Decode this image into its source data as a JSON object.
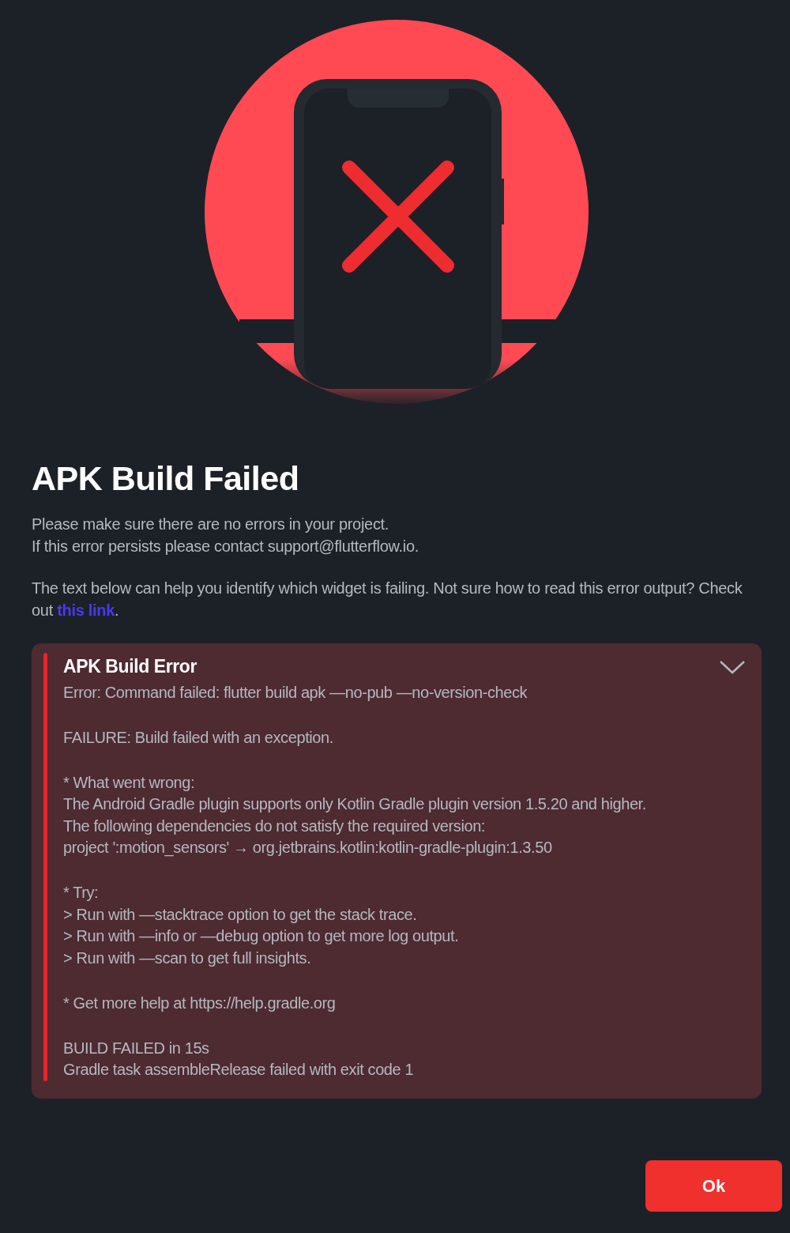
{
  "dialog": {
    "title": "APK Build Failed",
    "message_lines": [
      "Please make sure there are no errors in your project.",
      "If this error persists please contact support@flutterflow.io."
    ],
    "help_text": "The text below can help you identify which widget is failing. Not sure how to read this error output? Check out ",
    "help_link": "this link",
    "help_end": ".",
    "error_panel": {
      "title": "APK Build Error",
      "expanded": true,
      "blocks": [
        [
          "Error: Command failed: flutter build apk —no-pub —no-version-check"
        ],
        [
          "FAILURE: Build failed with an exception."
        ],
        [
          "* What went wrong:",
          "The Android Gradle plugin supports only Kotlin Gradle plugin version 1.5.20 and higher.",
          "The following dependencies do not satisfy the required version:",
          "project ':motion_sensors' → org.jetbrains.kotlin:kotlin-gradle-plugin:1.3.50"
        ],
        [
          "* Try:",
          "> Run with —stacktrace option to get the stack trace.",
          "> Run with —info or —debug option to get more log output.",
          "> Run with —scan to get full insights."
        ],
        [
          "* Get more help at https://help.gradle.org"
        ],
        [
          "BUILD FAILED in 15s",
          "Gradle task assembleRelease failed with exit code 1"
        ]
      ]
    },
    "buttons": [
      {
        "label": "Ok"
      }
    ]
  }
}
